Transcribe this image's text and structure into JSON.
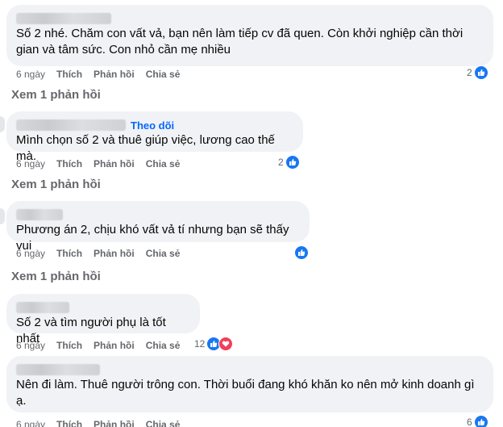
{
  "comments": [
    {
      "text": "Số 2 nhé. Chăm con vất vả, bạn nên làm tiếp cv đã quen. Còn khởi nghiệp cần thời gian và tâm sức. Con nhỏ cần mẹ nhiều",
      "time": "6 ngày",
      "like": "Thích",
      "reply": "Phản hồi",
      "share": "Chia sẻ",
      "reaction_count": "2",
      "reactions": [
        "like-icon"
      ]
    },
    {
      "follow": "Theo dõi",
      "text": "Mình chọn số 2 và thuê giúp việc, lương cao thế mà.",
      "time": "6 ngày",
      "like": "Thích",
      "reply": "Phản hồi",
      "share": "Chia sẻ",
      "reaction_count": "2",
      "reactions": [
        "like-icon"
      ]
    },
    {
      "text": "Phương án 2, chịu khó vất vả tí nhưng bạn sẽ thấy vui",
      "time": "6 ngày",
      "like": "Thích",
      "reply": "Phản hồi",
      "share": "Chia sẻ",
      "reaction_count": "",
      "reactions": [
        "like-icon"
      ]
    },
    {
      "text": "Số 2 và tìm người phụ là tốt nhất",
      "time": "6 ngày",
      "like": "Thích",
      "reply": "Phản hồi",
      "share": "Chia sẻ",
      "reaction_count": "12",
      "reactions": [
        "like-icon",
        "love-icon"
      ]
    },
    {
      "text": "Nên đi làm. Thuê người trông con. Thời buổi đang khó khăn ko nên mở kinh doanh gì ạ.",
      "time": "6 ngày",
      "like": "Thích",
      "reply": "Phản hồi",
      "share": "Chia sẻ",
      "reaction_count": "6",
      "reactions": [
        "like-icon"
      ]
    }
  ],
  "view_replies": [
    "Xem 1 phản hồi",
    "Xem 1 phản hồi",
    "Xem 1 phản hồi"
  ],
  "colors": {
    "bubble": "#f0f2f5",
    "link": "#0866ff",
    "meta": "#65676b",
    "like": "#1877f2",
    "love": "#f33e58"
  }
}
